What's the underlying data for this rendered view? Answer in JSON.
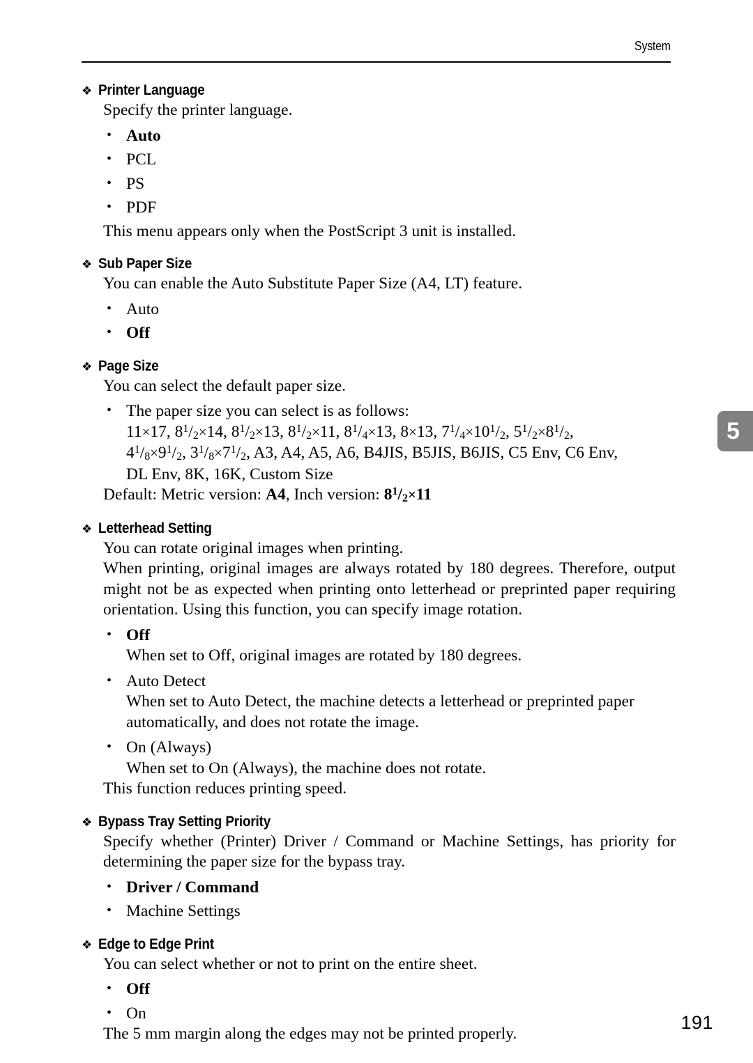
{
  "header": {
    "title": "System",
    "rule": true
  },
  "chapter_tab": {
    "number": "5",
    "color": "#808080",
    "text_color": "#ffffff"
  },
  "page_number": "191",
  "bullet_glyph": "❖",
  "sections": [
    {
      "title": "Printer Language",
      "intro": "Specify the printer language.",
      "options": [
        {
          "label": "Auto",
          "bold": true
        },
        {
          "label": "PCL",
          "bold": false
        },
        {
          "label": "PS",
          "bold": false
        },
        {
          "label": "PDF",
          "bold": false
        }
      ],
      "note": "This menu appears only when the PostScript 3 unit is installed."
    },
    {
      "title": "Sub Paper Size",
      "intro": "You can enable the Auto Substitute Paper Size (A4, LT) feature.",
      "options": [
        {
          "label": "Auto",
          "bold": false
        },
        {
          "label": "Off",
          "bold": true
        }
      ]
    },
    {
      "title": "Page Size",
      "intro": "You can select the default paper size.",
      "size_option_lead": "The paper size you can select is as follows:",
      "size_lines": [
        "11×17, 8¹/₂×14, 8¹/₂×13, 8¹/₂×11, 8¹/₄×13, 8×13, 7¹/₄×10¹/₂, 5¹/₂×8¹/₂,",
        "4¹/₈×9¹/₂, 3¹/₈×7¹/₂, A3, A4, A5, A6, B4JIS, B5JIS, B6JIS, C5 Env, C6 Env,",
        "DL Env, 8K, 16K, Custom Size"
      ],
      "default_line": {
        "prefix": "Default: Metric version: ",
        "metric_value": "A4",
        "middle": ", Inch version: ",
        "inch_value": "8¹/₂×11"
      }
    },
    {
      "title": "Letterhead Setting",
      "intro": "You can rotate original images when printing.",
      "body": "When printing, original images are always rotated by 180 degrees. Therefore, output might not be as expected when printing onto letterhead or preprinted paper requiring orientation. Using this function, you can specify image rotation.",
      "options": [
        {
          "label": "Off",
          "bold": true,
          "description": "When set to Off, original images are rotated by 180 degrees."
        },
        {
          "label": "Auto Detect",
          "bold": false,
          "description": "When set to Auto Detect, the machine detects a letterhead or preprinted paper automatically, and does not rotate the image."
        },
        {
          "label": "On (Always)",
          "bold": false,
          "description": "When set to On (Always), the machine does not rotate."
        }
      ],
      "note": "This function reduces printing speed."
    },
    {
      "title": "Bypass Tray Setting Priority",
      "body": "Specify whether (Printer) Driver / Command or Machine Settings, has priority for determining the paper size for the bypass tray.",
      "options": [
        {
          "label": "Driver / Command",
          "bold": true
        },
        {
          "label": "Machine Settings",
          "bold": false
        }
      ]
    },
    {
      "title": "Edge to Edge Print",
      "intro": "You can select whether or not to print on the entire sheet.",
      "options": [
        {
          "label": "Off",
          "bold": true
        },
        {
          "label": "On",
          "bold": false
        }
      ],
      "note": "The 5 mm margin along the edges may not be printed properly."
    }
  ]
}
